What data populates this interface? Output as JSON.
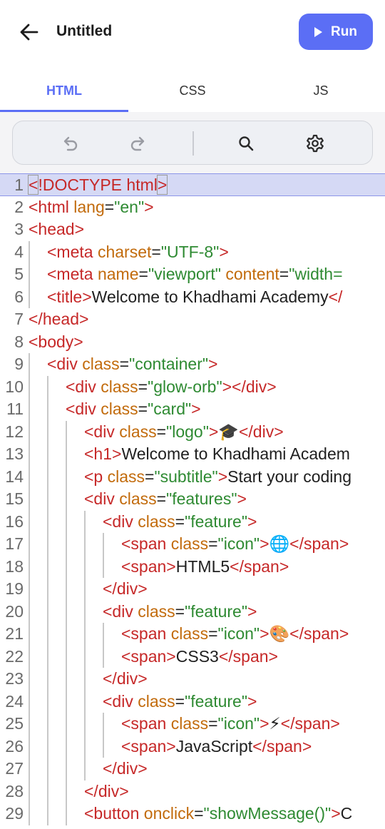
{
  "header": {
    "title": "Untitled",
    "run_label": "Run"
  },
  "tabs": [
    {
      "label": "HTML",
      "active": true
    },
    {
      "label": "CSS",
      "active": false
    },
    {
      "label": "JS",
      "active": false
    }
  ],
  "toolbar": {
    "icons": [
      "undo-icon",
      "redo-icon",
      "search-icon",
      "settings-icon"
    ]
  },
  "colors": {
    "accent": "#5b6ef5",
    "tag": "#c62828",
    "attribute": "#c26b0c",
    "string": "#2e8a32"
  },
  "editor": {
    "active_line": 1,
    "lines": [
      {
        "n": "1",
        "indent": 0,
        "tokens": [
          [
            "tag",
            "<"
          ],
          [
            "tag",
            "!DOCTYPE html"
          ],
          [
            "tag",
            ">"
          ]
        ]
      },
      {
        "n": "2",
        "indent": 0,
        "tokens": [
          [
            "tag",
            "<html "
          ],
          [
            "attr",
            "lang"
          ],
          [
            "txt",
            "="
          ],
          [
            "str",
            "\"en\""
          ],
          [
            "tag",
            ">"
          ]
        ]
      },
      {
        "n": "3",
        "indent": 0,
        "tokens": [
          [
            "tag",
            "<head>"
          ]
        ]
      },
      {
        "n": "4",
        "indent": 1,
        "tokens": [
          [
            "tag",
            "<meta "
          ],
          [
            "attr",
            "charset"
          ],
          [
            "txt",
            "="
          ],
          [
            "str",
            "\"UTF-8\""
          ],
          [
            "tag",
            ">"
          ]
        ]
      },
      {
        "n": "5",
        "indent": 1,
        "tokens": [
          [
            "tag",
            "<meta "
          ],
          [
            "attr",
            "name"
          ],
          [
            "txt",
            "="
          ],
          [
            "str",
            "\"viewport\""
          ],
          [
            "txt",
            " "
          ],
          [
            "attr",
            "content"
          ],
          [
            "txt",
            "="
          ],
          [
            "str",
            "\"width="
          ]
        ]
      },
      {
        "n": "6",
        "indent": 1,
        "tokens": [
          [
            "tag",
            "<title>"
          ],
          [
            "txt",
            "Welcome to Khadhami Academy"
          ],
          [
            "tag",
            "</"
          ]
        ]
      },
      {
        "n": "7",
        "indent": 0,
        "tokens": [
          [
            "tag",
            "</head>"
          ]
        ]
      },
      {
        "n": "8",
        "indent": 0,
        "tokens": [
          [
            "tag",
            "<body>"
          ]
        ]
      },
      {
        "n": "9",
        "indent": 1,
        "tokens": [
          [
            "tag",
            "<div "
          ],
          [
            "attr",
            "class"
          ],
          [
            "txt",
            "="
          ],
          [
            "str",
            "\"container\""
          ],
          [
            "tag",
            ">"
          ]
        ]
      },
      {
        "n": "10",
        "indent": 2,
        "tokens": [
          [
            "tag",
            "<div "
          ],
          [
            "attr",
            "class"
          ],
          [
            "txt",
            "="
          ],
          [
            "str",
            "\"glow-orb\""
          ],
          [
            "tag",
            "></div>"
          ]
        ]
      },
      {
        "n": "11",
        "indent": 2,
        "tokens": [
          [
            "tag",
            "<div "
          ],
          [
            "attr",
            "class"
          ],
          [
            "txt",
            "="
          ],
          [
            "str",
            "\"card\""
          ],
          [
            "tag",
            ">"
          ]
        ]
      },
      {
        "n": "12",
        "indent": 3,
        "tokens": [
          [
            "tag",
            "<div "
          ],
          [
            "attr",
            "class"
          ],
          [
            "txt",
            "="
          ],
          [
            "str",
            "\"logo\""
          ],
          [
            "tag",
            ">"
          ],
          [
            "txt",
            "🎓"
          ],
          [
            "tag",
            "</div>"
          ]
        ]
      },
      {
        "n": "13",
        "indent": 3,
        "tokens": [
          [
            "tag",
            "<h1>"
          ],
          [
            "txt",
            "Welcome to Khadhami Academ"
          ]
        ]
      },
      {
        "n": "14",
        "indent": 3,
        "tokens": [
          [
            "tag",
            "<p "
          ],
          [
            "attr",
            "class"
          ],
          [
            "txt",
            "="
          ],
          [
            "str",
            "\"subtitle\""
          ],
          [
            "tag",
            ">"
          ],
          [
            "txt",
            "Start your coding"
          ]
        ]
      },
      {
        "n": "15",
        "indent": 3,
        "tokens": [
          [
            "tag",
            "<div "
          ],
          [
            "attr",
            "class"
          ],
          [
            "txt",
            "="
          ],
          [
            "str",
            "\"features\""
          ],
          [
            "tag",
            ">"
          ]
        ]
      },
      {
        "n": "16",
        "indent": 4,
        "tokens": [
          [
            "tag",
            "<div "
          ],
          [
            "attr",
            "class"
          ],
          [
            "txt",
            "="
          ],
          [
            "str",
            "\"feature\""
          ],
          [
            "tag",
            ">"
          ]
        ]
      },
      {
        "n": "17",
        "indent": 5,
        "tokens": [
          [
            "tag",
            "<span "
          ],
          [
            "attr",
            "class"
          ],
          [
            "txt",
            "="
          ],
          [
            "str",
            "\"icon\""
          ],
          [
            "tag",
            ">"
          ],
          [
            "txt",
            "🌐"
          ],
          [
            "tag",
            "</span>"
          ]
        ]
      },
      {
        "n": "18",
        "indent": 5,
        "tokens": [
          [
            "tag",
            "<span>"
          ],
          [
            "txt",
            "HTML5"
          ],
          [
            "tag",
            "</span>"
          ]
        ]
      },
      {
        "n": "19",
        "indent": 4,
        "tokens": [
          [
            "tag",
            "</div>"
          ]
        ]
      },
      {
        "n": "20",
        "indent": 4,
        "tokens": [
          [
            "tag",
            "<div "
          ],
          [
            "attr",
            "class"
          ],
          [
            "txt",
            "="
          ],
          [
            "str",
            "\"feature\""
          ],
          [
            "tag",
            ">"
          ]
        ]
      },
      {
        "n": "21",
        "indent": 5,
        "tokens": [
          [
            "tag",
            "<span "
          ],
          [
            "attr",
            "class"
          ],
          [
            "txt",
            "="
          ],
          [
            "str",
            "\"icon\""
          ],
          [
            "tag",
            ">"
          ],
          [
            "txt",
            "🎨"
          ],
          [
            "tag",
            "</span>"
          ]
        ]
      },
      {
        "n": "22",
        "indent": 5,
        "tokens": [
          [
            "tag",
            "<span>"
          ],
          [
            "txt",
            "CSS3"
          ],
          [
            "tag",
            "</span>"
          ]
        ]
      },
      {
        "n": "23",
        "indent": 4,
        "tokens": [
          [
            "tag",
            "</div>"
          ]
        ]
      },
      {
        "n": "24",
        "indent": 4,
        "tokens": [
          [
            "tag",
            "<div "
          ],
          [
            "attr",
            "class"
          ],
          [
            "txt",
            "="
          ],
          [
            "str",
            "\"feature\""
          ],
          [
            "tag",
            ">"
          ]
        ]
      },
      {
        "n": "25",
        "indent": 5,
        "tokens": [
          [
            "tag",
            "<span "
          ],
          [
            "attr",
            "class"
          ],
          [
            "txt",
            "="
          ],
          [
            "str",
            "\"icon\""
          ],
          [
            "tag",
            ">"
          ],
          [
            "txt",
            "⚡"
          ],
          [
            "tag",
            "</span>"
          ]
        ]
      },
      {
        "n": "26",
        "indent": 5,
        "tokens": [
          [
            "tag",
            "<span>"
          ],
          [
            "txt",
            "JavaScript"
          ],
          [
            "tag",
            "</span>"
          ]
        ]
      },
      {
        "n": "27",
        "indent": 4,
        "tokens": [
          [
            "tag",
            "</div>"
          ]
        ]
      },
      {
        "n": "28",
        "indent": 3,
        "tokens": [
          [
            "tag",
            "</div>"
          ]
        ]
      },
      {
        "n": "29",
        "indent": 3,
        "tokens": [
          [
            "tag",
            "<button "
          ],
          [
            "attr",
            "onclick"
          ],
          [
            "txt",
            "="
          ],
          [
            "str",
            "\"showMessage()\""
          ],
          [
            "tag",
            ">"
          ],
          [
            "txt",
            "C"
          ]
        ]
      }
    ]
  }
}
